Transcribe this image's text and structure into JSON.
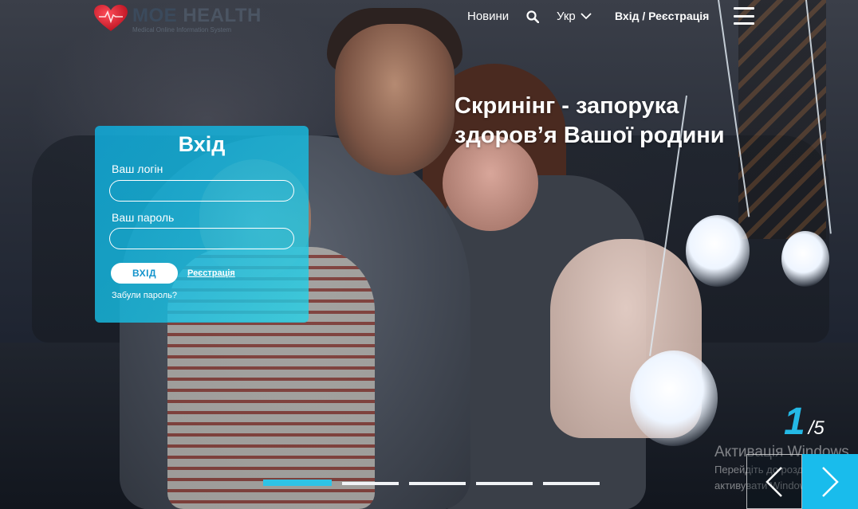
{
  "header": {
    "logo_name_bold": "МОЕ",
    "logo_name_rest": "HEALTH",
    "logo_subtitle": "Medical Online Information System",
    "nav": {
      "news": "Новини",
      "search_icon": "search-icon",
      "language": "Укр",
      "login_register": "Вхід / Реєстрація",
      "menu_icon": "hamburger-menu-icon"
    }
  },
  "hero": {
    "headline_line1": "Скринінг - запорука",
    "headline_line2": "здоров’я Вашої родини"
  },
  "login_card": {
    "title": "Вхід",
    "login_label": "Ваш логін",
    "login_value": "",
    "password_label": "Ваш пароль",
    "password_value": "",
    "submit": "ВХІД",
    "register": "Реєстрація",
    "forgot": "Забули пароль?"
  },
  "slider": {
    "current": "1",
    "total": "/5",
    "active_index": 0,
    "dot_count": 5
  },
  "watermark": {
    "title": "Активація Windows",
    "line1": "Перейдіть до розділу \"Налаштування\", щоб",
    "line2": "активувати Windows."
  },
  "colors": {
    "accent": "#19bcec",
    "card_bg": "#10acdc",
    "slide_current": "#24b9e6"
  }
}
